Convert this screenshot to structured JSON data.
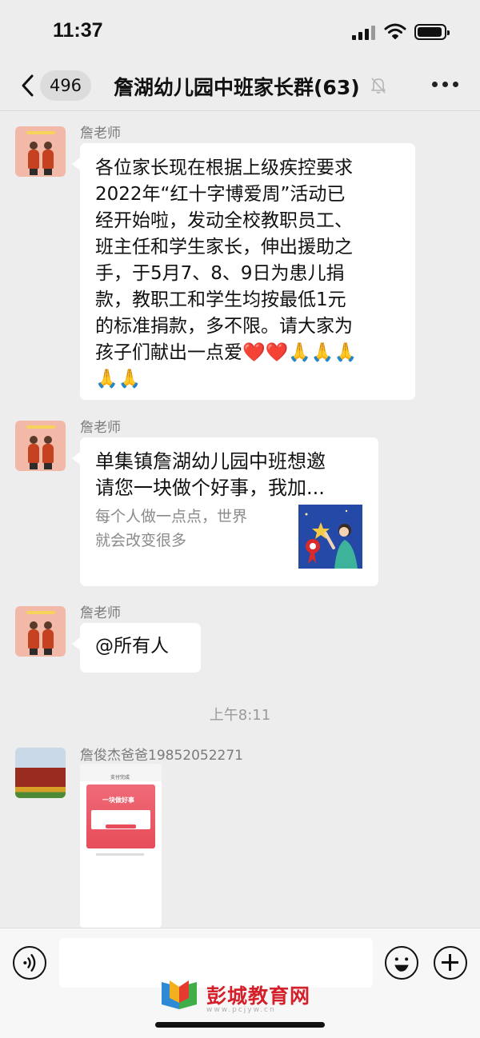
{
  "status_bar": {
    "time": "11:37"
  },
  "header": {
    "unread_count": "496",
    "title": "詹湖幼儿园中班家长群(63)"
  },
  "messages": [
    {
      "sender": "詹老师",
      "type": "text",
      "text": "各位家长现在根据上级疾控要求\n2022年“红十字博爱周”活动已\n经开始啦，发动全校教职员工、\n班主任和学生家长，伸出援助之\n手，于5月7、8、9日为患儿捐\n款，教职工和学生均按最低1元\n的标准捐款，多不限。请大家为\n孩子们献出一点爱❤️❤️🙏🙏🙏\n🙏🙏"
    },
    {
      "sender": "詹老师",
      "type": "link_card",
      "title": "单集镇詹湖幼儿园中班想邀\n请您一块做个好事，我加...",
      "description": "每个人做一点点，世界\n就会改变很多"
    },
    {
      "sender": "詹老师",
      "type": "text",
      "text": "@所有人"
    },
    {
      "sender": "詹俊杰爸爸19852052271",
      "type": "image",
      "image_header": "支付完成",
      "poster_title": "一块做好事"
    }
  ],
  "time_divider": "上午8:11",
  "watermark": {
    "name": "彭城教育网",
    "url": "www.pcjyw.cn"
  }
}
